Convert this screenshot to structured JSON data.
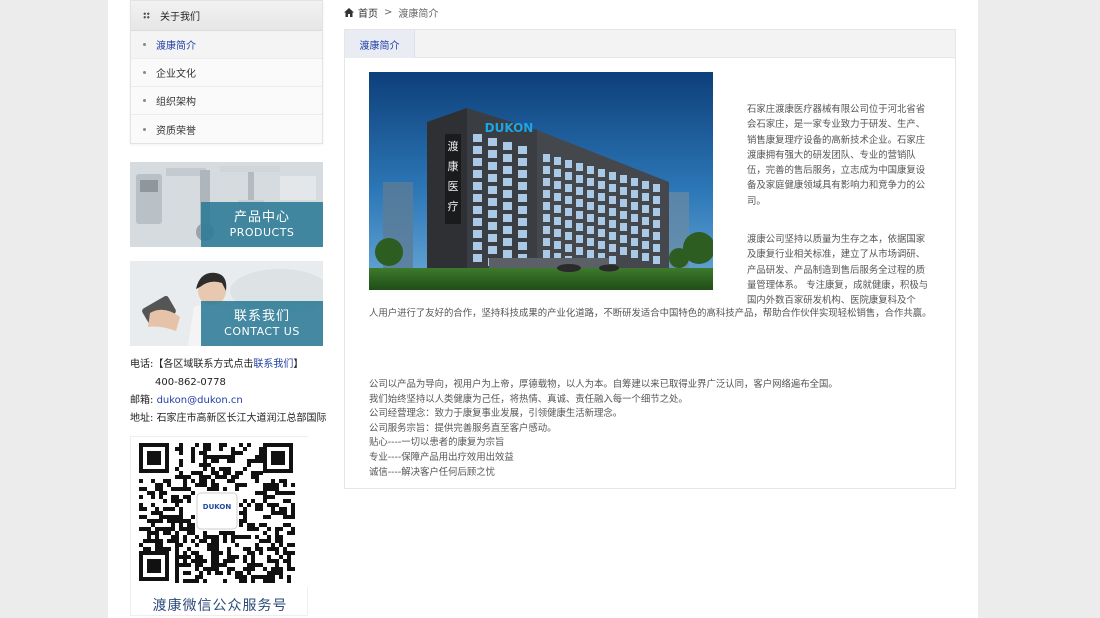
{
  "sidebar": {
    "menu_title": "关于我们",
    "items": [
      {
        "label": "渡康简介"
      },
      {
        "label": "企业文化"
      },
      {
        "label": "组织架构"
      },
      {
        "label": "资质荣誉"
      }
    ],
    "banners": [
      {
        "cn": "产品中心",
        "en": "PRODUCTS"
      },
      {
        "cn": "联系我们",
        "en": "CONTACT US"
      }
    ],
    "contact": {
      "phone_prefix": "电话:【各区域联系方式点击",
      "phone_link": "联系我们",
      "phone_suffix": "】",
      "phone_number": "400-862-0778",
      "mail_label": "邮箱:",
      "mail": "dukon@dukon.cn",
      "addr_label": "地址:",
      "addr": "石家庄市高新区长江大道润江总部国际"
    },
    "qr_caption": "渡康微信公众服务号",
    "qr_logo_text": "DUKON"
  },
  "breadcrumb": {
    "home": "首页",
    "sep": ">",
    "current": "渡康简介"
  },
  "tab": {
    "label": "渡康简介"
  },
  "photo": {
    "sign_text": "DUKON",
    "building_cn": [
      "渡",
      "康",
      "医",
      "疗"
    ]
  },
  "article": {
    "p1": "石家庄渡康医疗器械有限公司位于河北省省会石家庄，是一家专业致力于研发、生产、销售康复理疗设备的高新技术企业。石家庄渡康拥有强大的研发团队、专业的营销队伍，完善的售后服务，立志成为中国康复设备及家庭健康领域具有影响力和竞争力的公司。",
    "p2": "渡康公司坚持以质量为生存之本，依据国家及康复行业相关标准，建立了从市场调研、产品研发、产品制造到售后服务全过程的质量管理体系。 专注康复，成就健康，积极与国内外数百家研发机构、医院康复科及个",
    "p2b": "人用户进行了友好的合作，坚持科技成果的产业化道路，不断研发适合中国特色的高科技产品，帮助合作伙伴实现轻松销售，合作共赢。",
    "list": [
      "公司以产品为导向，视用户为上帝，厚德载物，以人为本。自筹建以来已取得业界广泛认同，客户网络遍布全国。",
      "我们始终坚持以人类健康为己任，将热情、真诚、责任融入每一个细节之处。",
      "公司经营理念：致力于康复事业发展，引领健康生活新理念。",
      "公司服务宗旨：提供完善服务直至客户感动。",
      "贴心----一切以患者的康复为宗旨",
      "专业----保障产品用出疗效用出效益",
      "诚信----解决客户任何后顾之忧"
    ]
  },
  "colors": {
    "accent": "#1f3fa5",
    "banner_box": "#2c7a96",
    "page_bg": "#ececec"
  }
}
